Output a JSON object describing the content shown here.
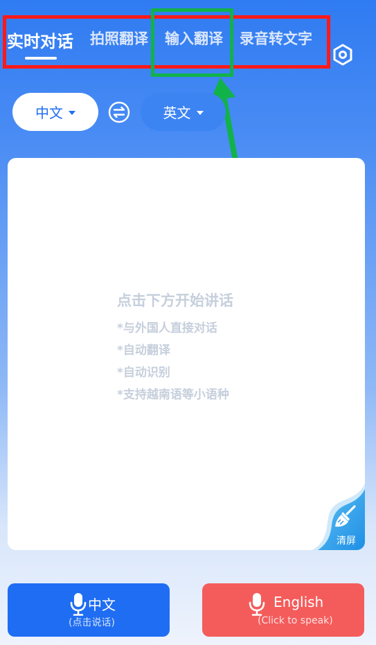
{
  "tabs": [
    {
      "label": "实时对话",
      "active": true
    },
    {
      "label": "拍照翻译",
      "active": false
    },
    {
      "label": "输入翻译",
      "active": false
    },
    {
      "label": "录音转文字",
      "active": false
    }
  ],
  "icons": {
    "settings": "hexagon-settings-icon",
    "swap": "swap-arrows-icon",
    "clear": "broom-icon",
    "mic": "microphone-icon"
  },
  "languages": {
    "source": "中文",
    "target": "英文"
  },
  "panel": {
    "hint_title": "点击下方开始讲话",
    "hint_lines": [
      "*与外国人直接对话",
      "*自动翻译",
      "*自动识别",
      "*支持越南语等小语种"
    ],
    "clear_label": "清屏"
  },
  "speak_buttons": {
    "chinese": {
      "label": "中文",
      "sub": "(点击说话)"
    },
    "english": {
      "label": "English",
      "sub": "(Click to speak)"
    }
  },
  "colors": {
    "primary_blue": "#1f6df2",
    "english_red": "#f45c5c",
    "annotation_red": "#ff1a1a",
    "annotation_green": "#12b24a"
  }
}
